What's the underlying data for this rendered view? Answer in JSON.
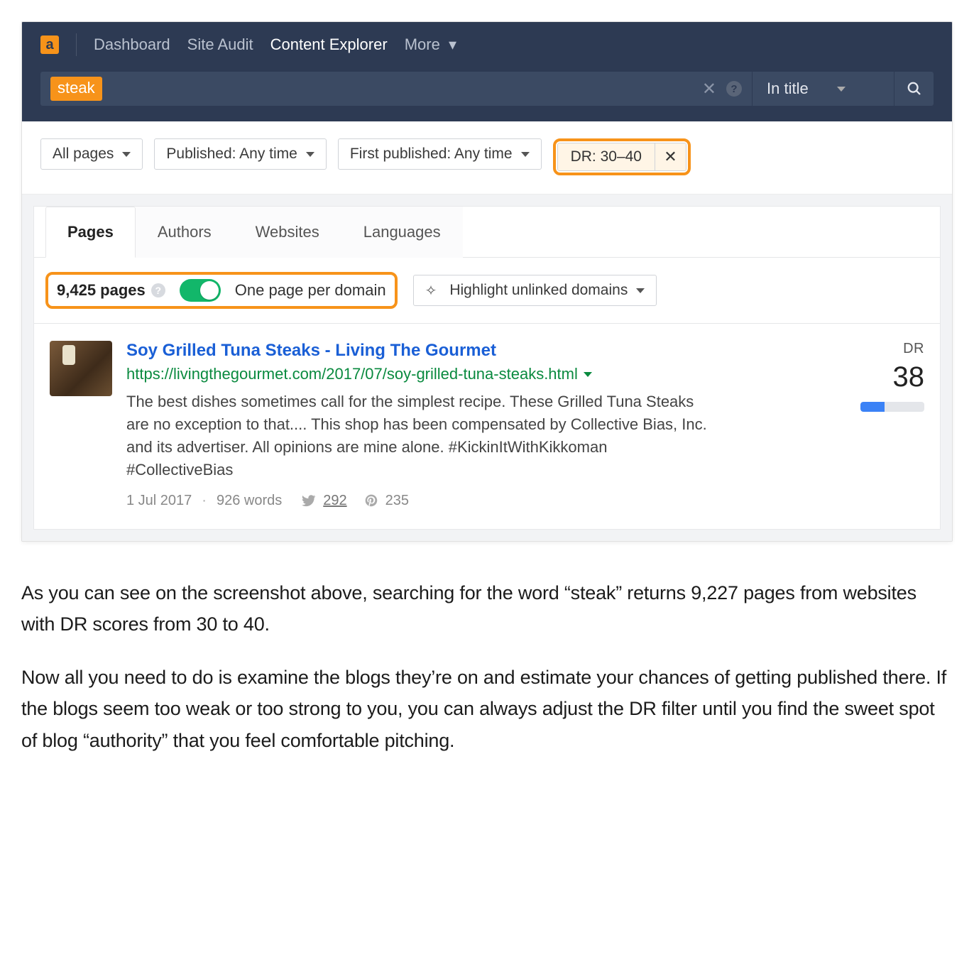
{
  "nav": {
    "items": [
      "Dashboard",
      "Site Audit",
      "Content Explorer",
      "More"
    ],
    "active_index": 2
  },
  "search": {
    "tag": "steak",
    "scope_label": "In title"
  },
  "filters": {
    "all_pages": "All pages",
    "published": "Published: Any time",
    "first_published": "First published: Any time",
    "dr_chip": "DR: 30–40"
  },
  "tabs": [
    "Pages",
    "Authors",
    "Websites",
    "Languages"
  ],
  "results_header": {
    "count": "9,425 pages",
    "toggle_label": "One page per domain",
    "highlight_label": "Highlight unlinked domains"
  },
  "result": {
    "title": "Soy Grilled Tuna Steaks - Living The Gourmet",
    "url": "https://livingthegourmet.com/2017/07/soy-grilled-tuna-steaks.html",
    "description": "The best dishes sometimes call for the simplest recipe. These Grilled Tuna Steaks are no exception to that.... This shop has been compensated by Collective Bias, Inc. and its advertiser. All opinions are mine alone. #KickinItWithKikkoman #CollectiveBias",
    "date": "1 Jul 2017",
    "words": "926 words",
    "twitter_count": "292",
    "pinterest_count": "235",
    "dr_label": "DR",
    "dr_value": "38"
  },
  "article": {
    "p1": "As you can see on the screenshot above, searching for the word “steak” returns 9,227 pages from websites with DR scores from 30 to 40.",
    "p2": "Now all you need to do is examine the blogs they’re on and estimate your chances of getting published there. If the blogs seem too weak or too strong to you, you can always adjust the DR filter until you find the sweet spot of blog “authority” that you feel comfortable pitching."
  }
}
